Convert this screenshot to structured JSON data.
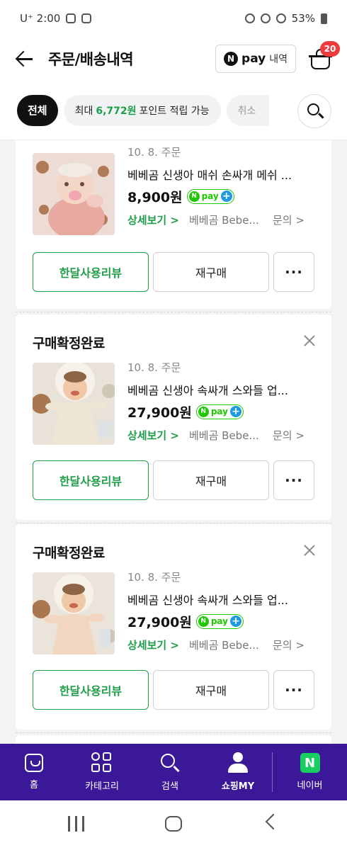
{
  "status": {
    "carrier": "U⁺ 2:00",
    "battery": "53%"
  },
  "header": {
    "title": "주문/배송내역",
    "npay_logo": "N",
    "npay_word": "pay",
    "npay_sub": "내역",
    "cart_count": "20"
  },
  "filters": {
    "all": "전체",
    "point_prefix": "최대",
    "point_amount": "6,772원",
    "point_suffix": "포인트 적립 가능",
    "cancel": "취소"
  },
  "orders": [
    {
      "status": "",
      "date": "10. 8. 주문",
      "name": "베베곰 신생아 매쉬 손싸개 메쉬 ...",
      "price": "8,900원",
      "detail": "상세보기 >",
      "seller": "베베곰 Bebe...",
      "inquiry": "문의 >",
      "review_btn": "한달사용리뷰",
      "rebuy_btn": "재구매",
      "more_btn": "···"
    },
    {
      "status": "구매확정완료",
      "date": "10. 8. 주문",
      "name": "베베곰 신생아 속싸개 스와들 업...",
      "price": "27,900원",
      "detail": "상세보기 >",
      "seller": "베베곰 Bebe...",
      "inquiry": "문의 >",
      "review_btn": "한달사용리뷰",
      "rebuy_btn": "재구매",
      "more_btn": "···"
    },
    {
      "status": "구매확정완료",
      "date": "10. 8. 주문",
      "name": "베베곰 신생아 속싸개 스와들 업...",
      "price": "27,900원",
      "detail": "상세보기 >",
      "seller": "베베곰 Bebe...",
      "inquiry": "문의 >",
      "review_btn": "한달사용리뷰",
      "rebuy_btn": "재구매",
      "more_btn": "···"
    }
  ],
  "npay_badge": {
    "n": "N",
    "word": "pay",
    "plus": "+"
  },
  "bottom_nav": [
    {
      "label": "홈",
      "icon": "home-icon"
    },
    {
      "label": "카테고리",
      "icon": "category-icon"
    },
    {
      "label": "검색",
      "icon": "search-icon"
    },
    {
      "label": "쇼핑MY",
      "icon": "user-icon"
    },
    {
      "label": "네이버",
      "icon": "naver-icon",
      "logo": "N"
    }
  ],
  "colors": {
    "accent_green": "#1f9e4a",
    "nav_purple": "#3a1897",
    "badge_red": "#ee3b3b",
    "npay_green": "#1ec800"
  }
}
